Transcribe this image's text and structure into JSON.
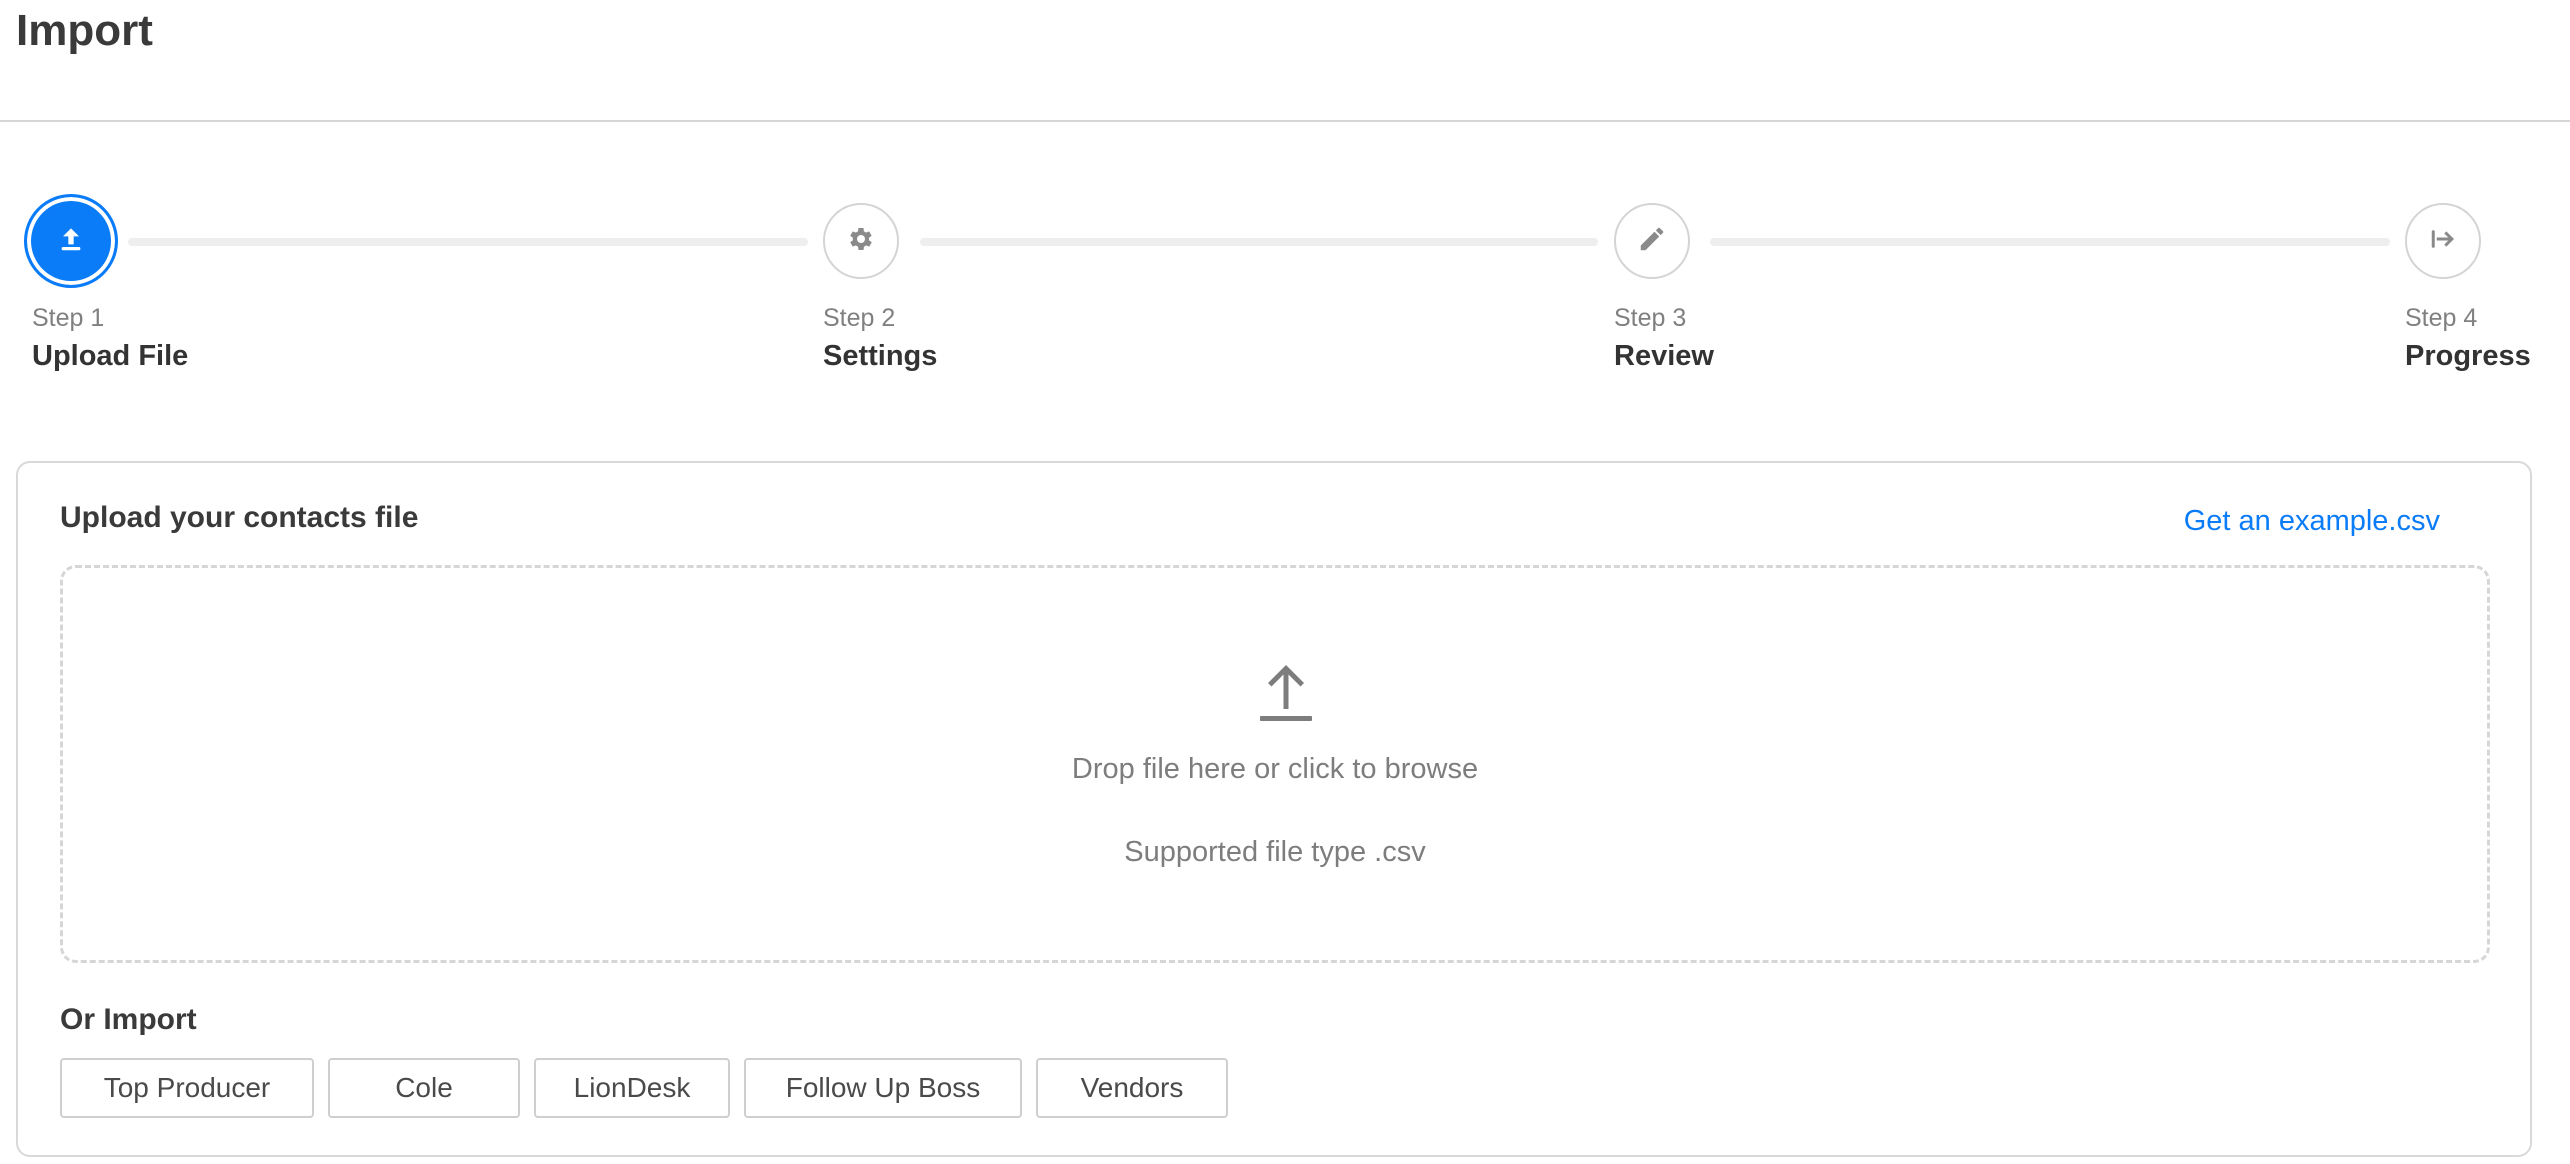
{
  "header": {
    "title": "Import"
  },
  "stepper": {
    "steps": [
      {
        "number_label": "Step 1",
        "name": "Upload File",
        "icon": "upload-icon",
        "active": true
      },
      {
        "number_label": "Step 2",
        "name": "Settings",
        "icon": "gear-icon",
        "active": false
      },
      {
        "number_label": "Step 3",
        "name": "Review",
        "icon": "pencil-icon",
        "active": false
      },
      {
        "number_label": "Step 4",
        "name": "Progress",
        "icon": "arrow-right-to-bar-icon",
        "active": false
      }
    ]
  },
  "upload": {
    "title": "Upload your contacts file",
    "example_link": "Get an example.csv",
    "dropzone": {
      "icon": "upload-arrow-icon",
      "main_text": "Drop file here or click to browse",
      "sub_text": "Supported file type .csv"
    }
  },
  "or_import": {
    "title": "Or Import",
    "buttons": [
      "Top Producer",
      "Cole",
      "LionDesk",
      "Follow Up Boss",
      "Vendors"
    ]
  },
  "colors": {
    "accent": "#0a7cf7",
    "border": "#d9d9d9",
    "muted_text": "#808080"
  }
}
